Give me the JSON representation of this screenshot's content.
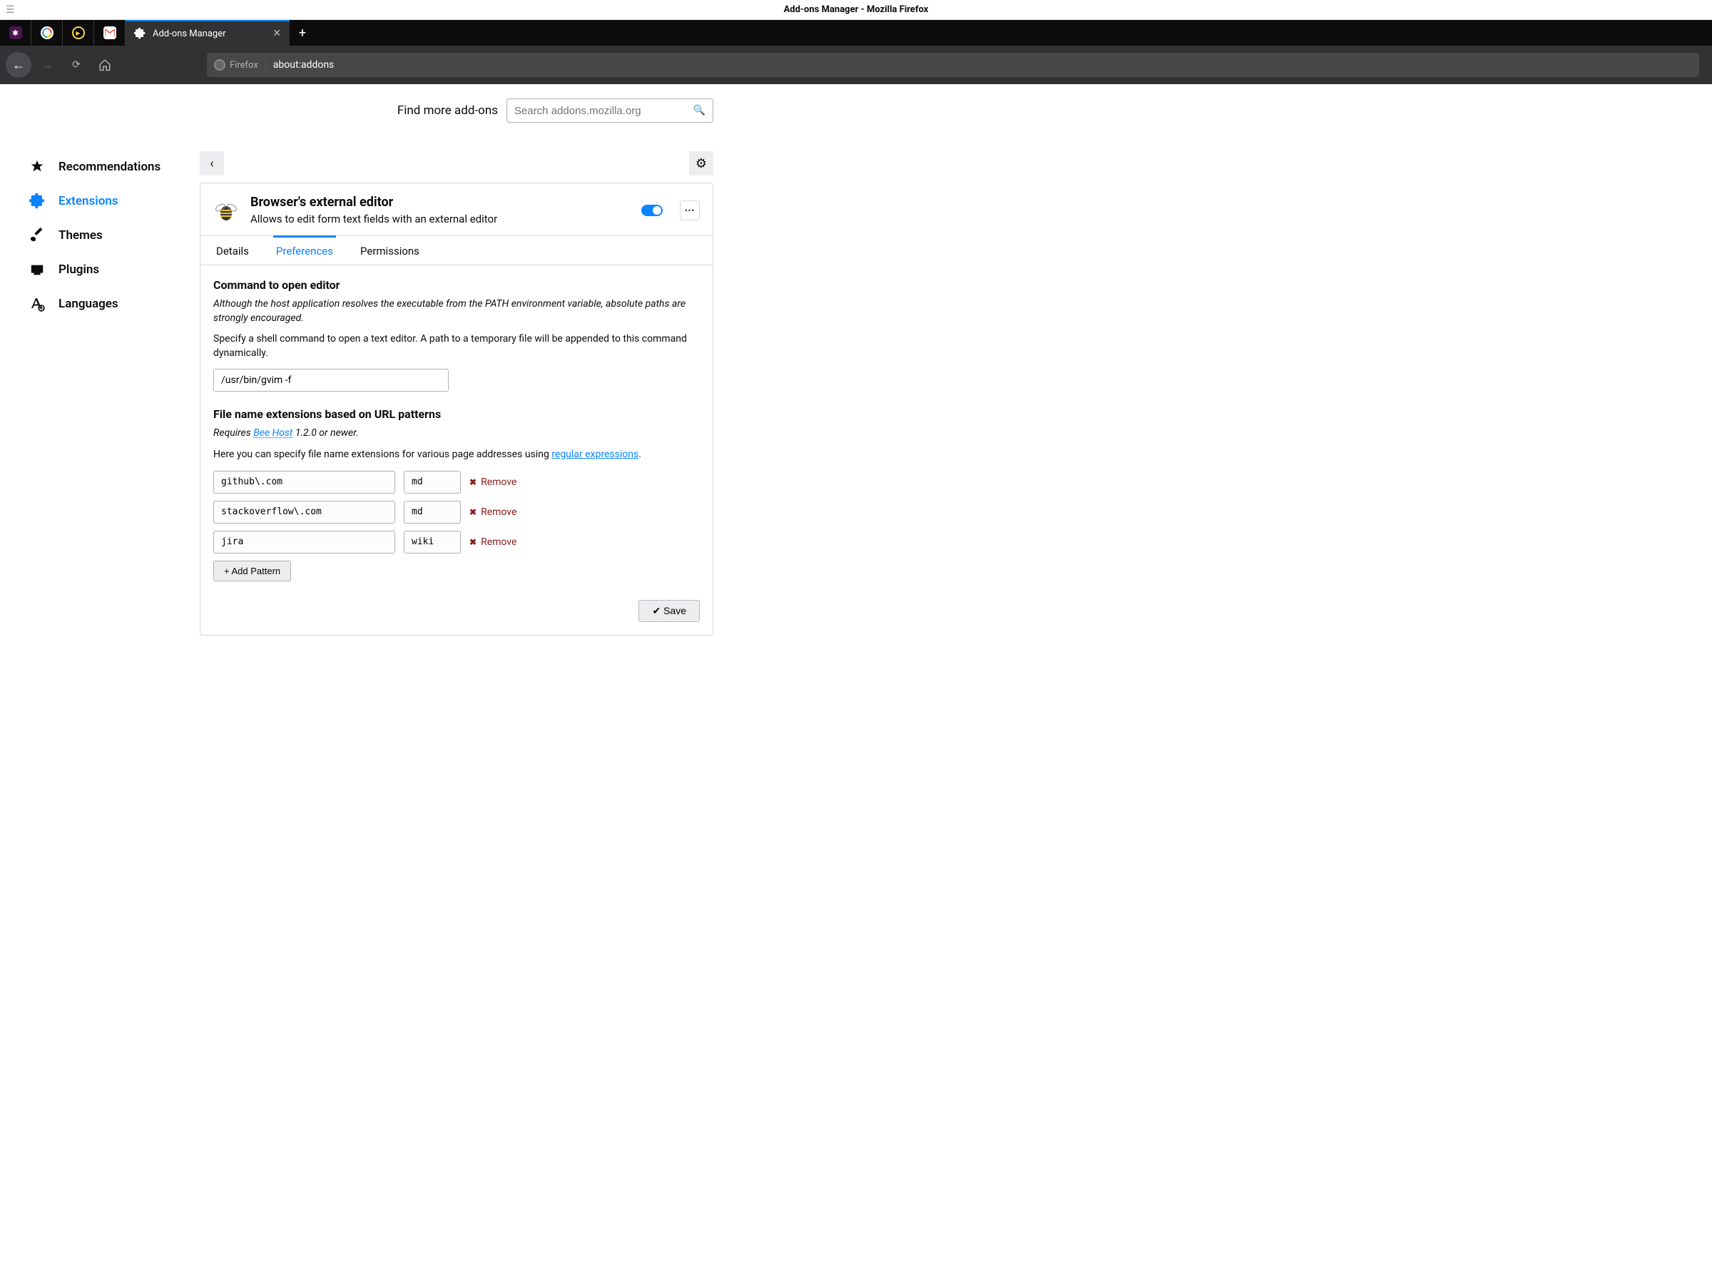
{
  "window": {
    "title": "Add-ons Manager - Mozilla Firefox"
  },
  "pinned_tabs": [
    {
      "name": "slack",
      "color": "#4a154b"
    },
    {
      "name": "google",
      "color": "#ffffff"
    },
    {
      "name": "media",
      "color": "#000000"
    },
    {
      "name": "gmail",
      "color": "#ffffff"
    }
  ],
  "active_tab": {
    "label": "Add-ons Manager"
  },
  "urlbar": {
    "identity": "Firefox",
    "url": "about:addons"
  },
  "search": {
    "label": "Find more add-ons",
    "placeholder": "Search addons.mozilla.org"
  },
  "sidebar": {
    "items": [
      {
        "key": "recommendations",
        "label": "Recommendations"
      },
      {
        "key": "extensions",
        "label": "Extensions"
      },
      {
        "key": "themes",
        "label": "Themes"
      },
      {
        "key": "plugins",
        "label": "Plugins"
      },
      {
        "key": "languages",
        "label": "Languages"
      }
    ],
    "active": "extensions"
  },
  "extension": {
    "name": "Browser's external editor",
    "description": "Allows to edit form text fields with an external editor",
    "enabled": true
  },
  "card_tabs": [
    {
      "key": "details",
      "label": "Details"
    },
    {
      "key": "preferences",
      "label": "Preferences"
    },
    {
      "key": "permissions",
      "label": "Permissions"
    }
  ],
  "active_card_tab": "preferences",
  "prefs": {
    "command_section": {
      "title": "Command to open editor",
      "note": "Although the host application resolves the executable from the PATH environment variable, absolute paths are strongly encouraged.",
      "help": "Specify a shell command to open a text editor. A path to a temporary file will be appended to this command dynamically.",
      "value": "/usr/bin/gvim -f"
    },
    "patterns_section": {
      "title": "File name extensions based on URL patterns",
      "requires_prefix": "Requires ",
      "requires_link": "Bee Host",
      "requires_suffix": " 1.2.0 or newer.",
      "help_prefix": "Here you can specify file name extensions for various page addresses using ",
      "help_link": "regular expressions",
      "help_suffix": ".",
      "rows": [
        {
          "pattern": "github\\.com",
          "ext": "md"
        },
        {
          "pattern": "stackoverflow\\.com",
          "ext": "md"
        },
        {
          "pattern": "jira",
          "ext": "wiki"
        }
      ],
      "remove_label": "Remove",
      "add_label": "+ Add Pattern"
    },
    "save_label": "✔ Save"
  }
}
